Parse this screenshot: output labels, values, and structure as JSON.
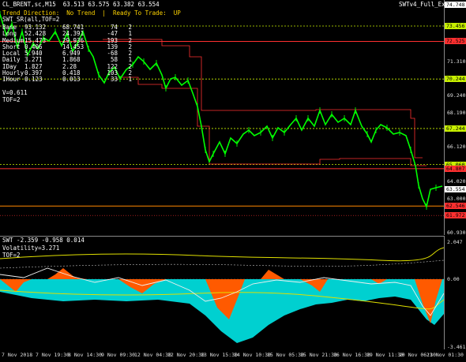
{
  "header": {
    "title": "CL_BRENT,sc,M15  63.513 63.575 63.382 63.554",
    "status": "Trend Direction:  No Trend  |  Ready To Trade:  UP",
    "indicator_name": "SWT_SR(all,TOF=2",
    "top_right": "SWTv4_Full_Exp"
  },
  "stats_table": [
    {
      "name": "Base",
      "a": "93.132",
      "b": "68.741",
      "c": "74",
      "d": "2"
    },
    {
      "name": "Long",
      "a": "52.428",
      "b": "24.391",
      "c": "-47",
      "d": "1"
    },
    {
      "name": "Medium",
      "a": "15.473",
      "b": "29.936",
      "c": "193",
      "d": "2"
    },
    {
      "name": "Short",
      "a": "0.406",
      "b": "14.453",
      "c": "139",
      "d": "2"
    },
    {
      "name": "Local",
      "a": "5.940",
      "b": "6.949",
      "c": "-68",
      "d": "2"
    },
    {
      "name": "Daily",
      "a": "3.271",
      "b": "1.868",
      "c": "58",
      "d": "1"
    },
    {
      "name": "IDay",
      "a": "1.827",
      "b": "2.28",
      "c": "122",
      "d": "2"
    },
    {
      "name": "Hourly",
      "a": "0.397",
      "b": "0.418",
      "c": "103",
      "d": "2"
    },
    {
      "name": "IHour",
      "a": "0.123",
      "b": "0.013",
      "c": "33",
      "d": "1"
    }
  ],
  "extra": {
    "v": "V=0.611",
    "tof": "TOF=2"
  },
  "price_axis": [
    "74.748",
    "73.456",
    "72.525",
    "71.310",
    "70.244",
    "69.240",
    "68.190",
    "67.244",
    "66.120",
    "65.060",
    "64.807",
    "64.020",
    "63.554",
    "63.000",
    "62.546",
    "61.972",
    "60.930"
  ],
  "price_tags": [
    {
      "label": "74.748",
      "color": "#ffffff"
    },
    {
      "label": "73.456",
      "color": "#c8f000"
    },
    {
      "label": "72.525",
      "color": "#ff3030"
    },
    {
      "label": "70.244",
      "color": "#c8f000"
    },
    {
      "label": "67.244",
      "color": "#c8f000"
    },
    {
      "label": "65.060",
      "color": "#c8f000"
    },
    {
      "label": "64.807",
      "color": "#ff3030"
    },
    {
      "label": "63.554",
      "color": "#ffffff"
    },
    {
      "label": "62.546",
      "color": "#ff3030"
    },
    {
      "label": "61.972",
      "color": "#ff3030"
    }
  ],
  "indicator": {
    "title": "SWT -2.359 -0.958 0.014",
    "volatility": "Volatility=3.271",
    "tof": "TOF=2",
    "axis": [
      "2.047",
      "0.00",
      "-3.461"
    ]
  },
  "time_axis": [
    "7 Nov 2018",
    "7 Nov 19:30",
    "8 Nov 14:30",
    "9 Nov 09:30",
    "12 Nov 04:30",
    "12 Nov 20:30",
    "13 Nov 15:30",
    "14 Nov 10:30",
    "15 Nov 05:30",
    "15 Nov 21:30",
    "16 Nov 16:30",
    "19 Nov 11:30",
    "20 Nov 06:30",
    "21 Nov 01:30"
  ],
  "colors": {
    "candle": "#00ff00",
    "resistance": "#ff3030",
    "support_line": "#ff8800",
    "level_lime": "#c8f000",
    "vol_fill": "#00d0d0",
    "osc_orange": "#ff5a00",
    "band_yellow": "#e0e000"
  }
}
